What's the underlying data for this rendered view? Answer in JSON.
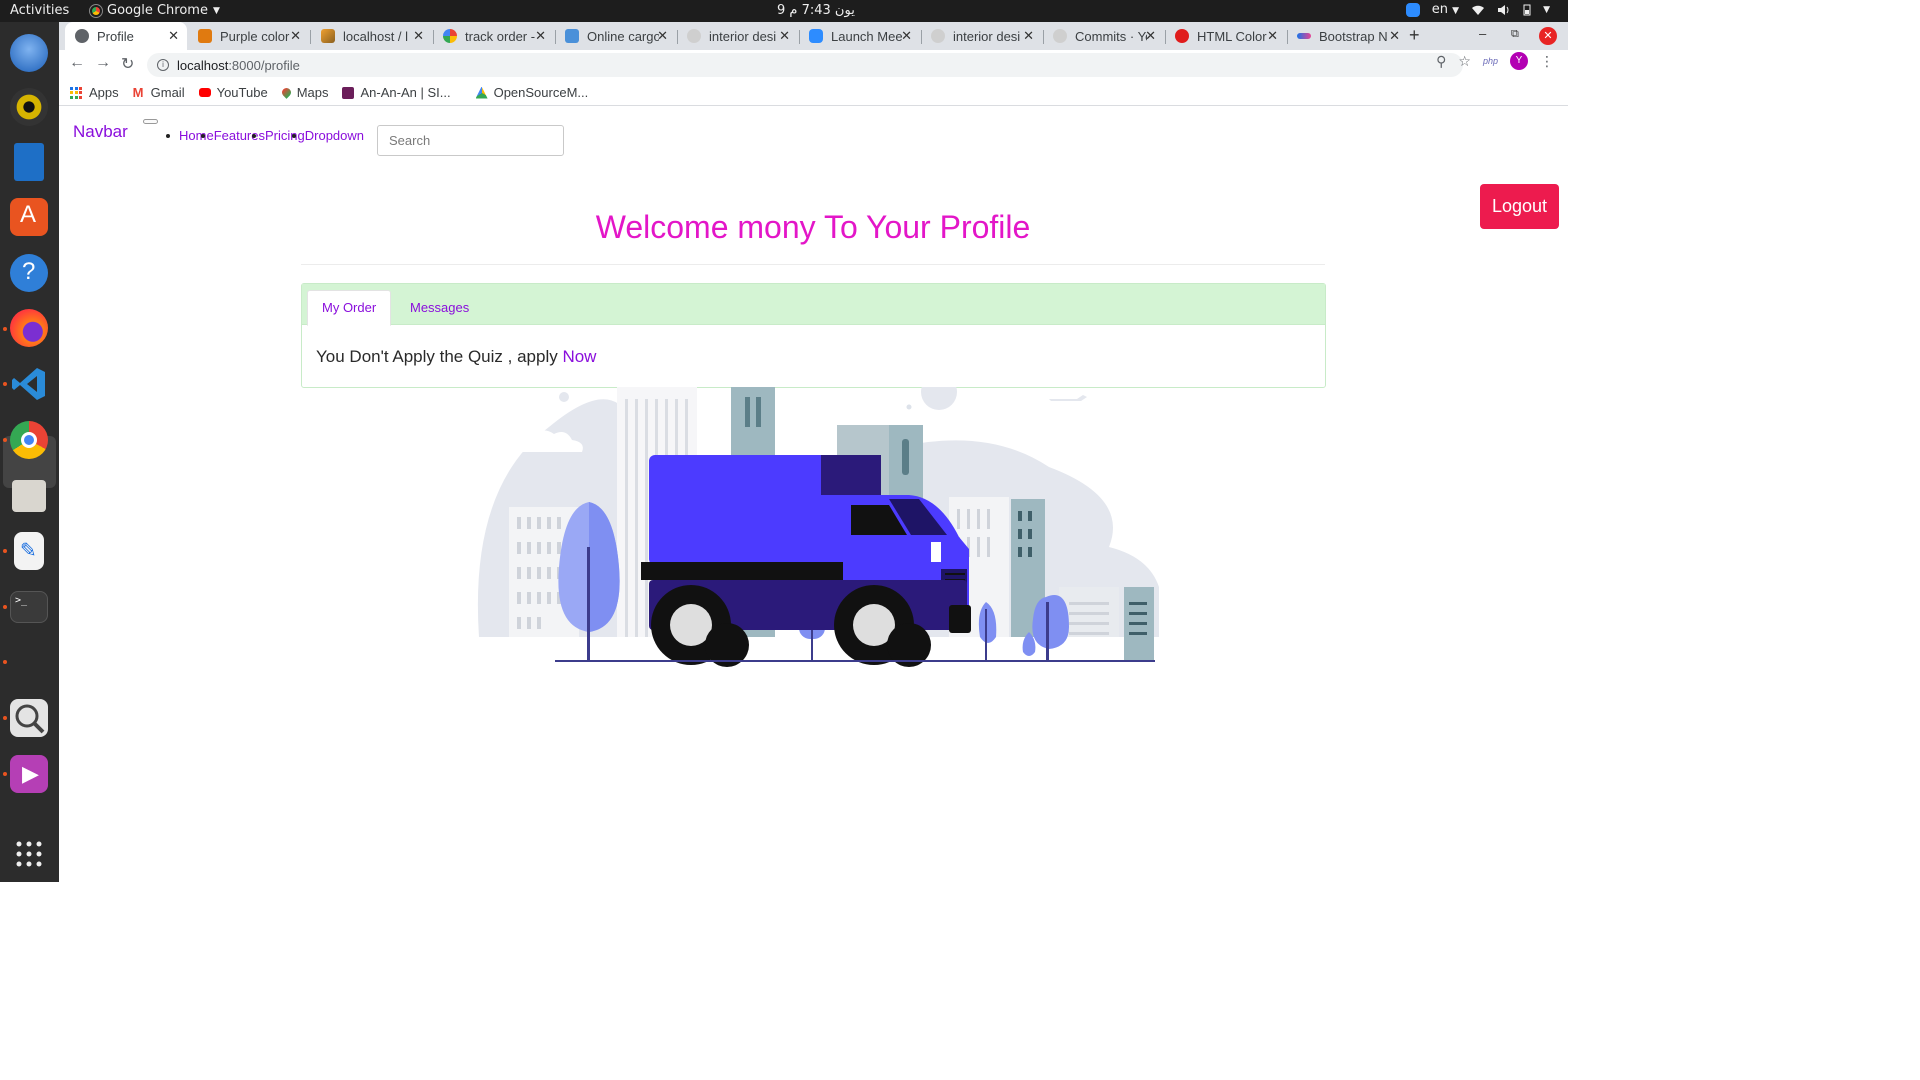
{
  "os": {
    "activities": "Activities",
    "app_name": "Google Chrome",
    "clock": "9 يون  7:43 م",
    "language": "en"
  },
  "browser": {
    "tabs": [
      {
        "title": "Profile",
        "favicon": "chrome-gear-icon",
        "active": true
      },
      {
        "title": "Purple color",
        "favicon": "r-icon"
      },
      {
        "title": "localhost / l",
        "favicon": "phpmyadmin-icon"
      },
      {
        "title": "track order -",
        "favicon": "google-icon"
      },
      {
        "title": "Online cargo",
        "favicon": "v-icon"
      },
      {
        "title": "interior desi",
        "favicon": "github-icon"
      },
      {
        "title": "Launch Mee",
        "favicon": "zoom-icon"
      },
      {
        "title": "interior desi",
        "favicon": "github-icon"
      },
      {
        "title": "Commits · Yo",
        "favicon": "github-icon"
      },
      {
        "title": "HTML Color",
        "favicon": "html-color-icon"
      },
      {
        "title": "Bootstrap N",
        "favicon": "bootstrap-icon"
      }
    ],
    "url_host": "localhost",
    "url_path": ":8000/profile",
    "extension_label": "php",
    "profile_initial": "Y",
    "bookmarks": [
      {
        "label": "Apps",
        "icon": "apps-grid-icon"
      },
      {
        "label": "Gmail",
        "icon": "gmail-icon"
      },
      {
        "label": "YouTube",
        "icon": "youtube-icon"
      },
      {
        "label": "Maps",
        "icon": "maps-icon"
      },
      {
        "label": "An-An-An | SI...",
        "icon": "s-icon"
      },
      {
        "label": "OpenSourceM...",
        "icon": "drive-icon"
      }
    ]
  },
  "page": {
    "brand": "Navbar",
    "nav": [
      "Home",
      "Features",
      "Pricing",
      "Dropdown"
    ],
    "search_placeholder": "Search",
    "logout_label": "Logout",
    "welcome_title": "Welcome mony To Your Profile",
    "tabs": [
      "My Order",
      "Messages"
    ],
    "order_message": "You Don't Apply the Quiz , apply ",
    "order_link": "Now",
    "colors": {
      "brand_purple": "#8a0edc",
      "title_magenta": "#e316c8",
      "logout_red": "#ed1b4e",
      "tab_header_green": "#d4f4d4",
      "truck_blue": "#4c3bff"
    },
    "illustration": "delivery-truck-illustration"
  }
}
